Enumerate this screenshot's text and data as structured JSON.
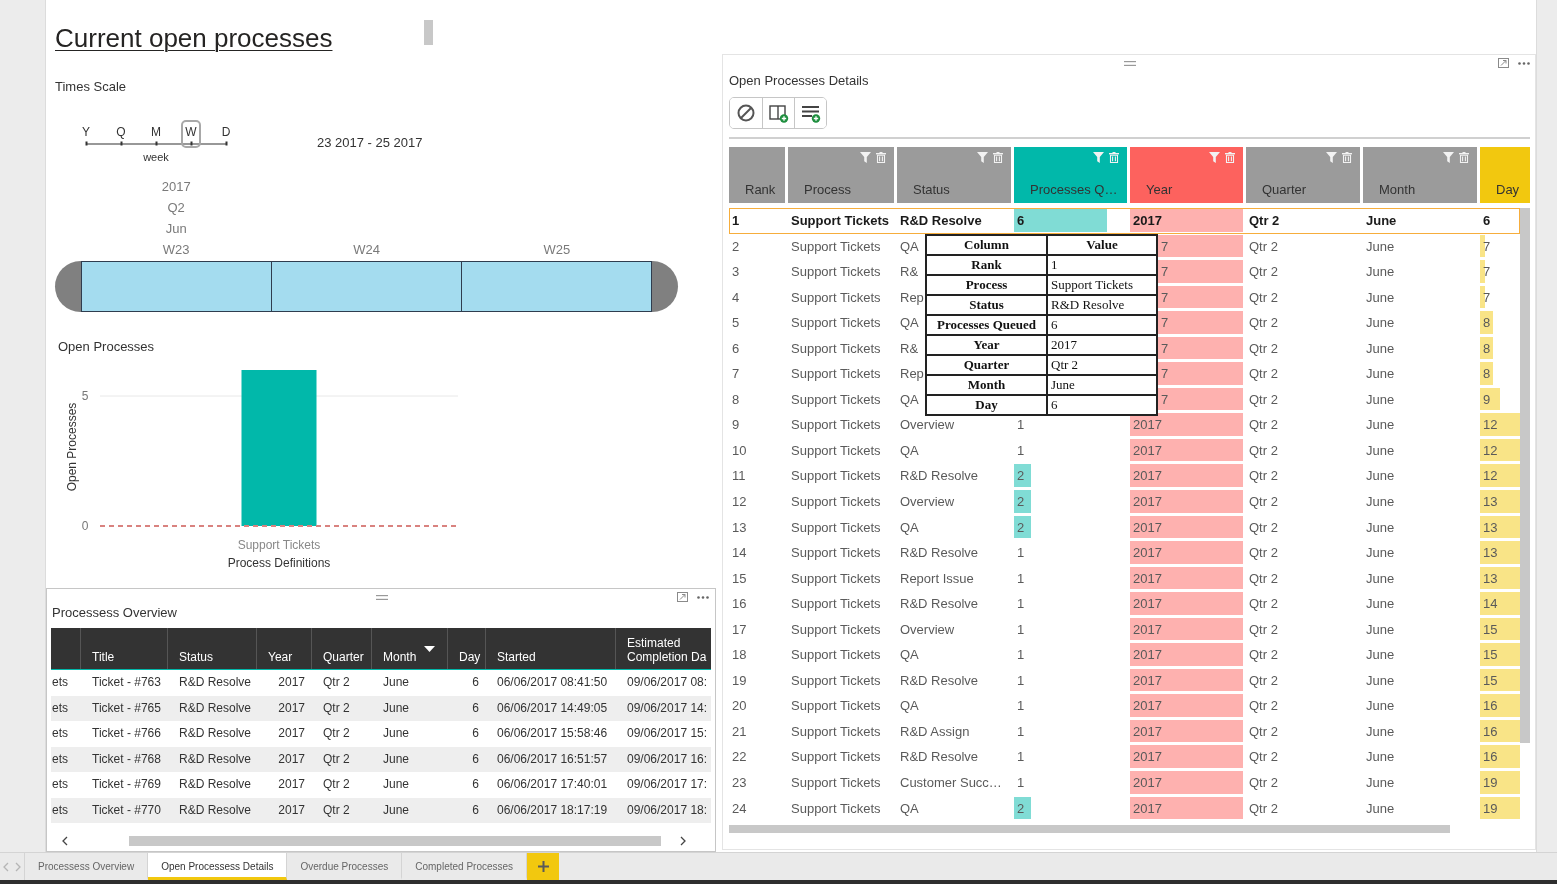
{
  "page": {
    "title": "Current open processes"
  },
  "time_scale": {
    "title": "Times Scale",
    "levels": [
      {
        "label": "Y",
        "selected": false
      },
      {
        "label": "Q",
        "selected": false
      },
      {
        "label": "M",
        "selected": false
      },
      {
        "label": "W",
        "selected": true
      },
      {
        "label": "D",
        "selected": false
      }
    ],
    "level_caption": "week",
    "range": "23 2017 - 25 2017",
    "year": "2017",
    "quarter": "Q2",
    "month": "Jun",
    "periods": [
      {
        "label": "W23",
        "selected": true
      },
      {
        "label": "W24",
        "selected": true
      },
      {
        "label": "W25",
        "selected": true
      }
    ]
  },
  "open_processes": {
    "title": "Open Processes",
    "chart_data": {
      "type": "bar",
      "categories": [
        "Support Tickets"
      ],
      "values": [
        6
      ],
      "color": "#01b8aa",
      "xlabel": "Process Definitions",
      "ylabel": "Open Processes",
      "yticks": [
        0,
        5
      ],
      "ylim": [
        0,
        6
      ],
      "grid": true,
      "ref_lines": [
        {
          "axis": "y",
          "value": 0,
          "color": "#d9827f",
          "line_style": "dashed"
        }
      ]
    }
  },
  "overview": {
    "title": "Processess Overview",
    "columns": [
      {
        "kind": "text"
      },
      {
        "label": "Title",
        "kind": "text"
      },
      {
        "label": "Status",
        "kind": "text"
      },
      {
        "label": "Year",
        "kind": "number"
      },
      {
        "label": "Quarter",
        "kind": "text"
      },
      {
        "label": "Month",
        "kind": "text",
        "sort_descending": true
      },
      {
        "label": "Day",
        "kind": "number"
      },
      {
        "label": "Started",
        "kind": "text"
      },
      {
        "label": "Estimated Completion Da",
        "kind": "text"
      }
    ],
    "rows": [
      [
        "ets",
        "Ticket - #763",
        "R&D Resolve",
        "2017",
        "Qtr 2",
        "June",
        "6",
        "06/06/2017 08:41:50",
        "09/06/2017 08:"
      ],
      [
        "ets",
        "Ticket - #765",
        "R&D Resolve",
        "2017",
        "Qtr 2",
        "June",
        "6",
        "06/06/2017 14:49:05",
        "09/06/2017 14:"
      ],
      [
        "ets",
        "Ticket - #766",
        "R&D Resolve",
        "2017",
        "Qtr 2",
        "June",
        "6",
        "06/06/2017 15:58:46",
        "09/06/2017 15:"
      ],
      [
        "ets",
        "Ticket - #768",
        "R&D Resolve",
        "2017",
        "Qtr 2",
        "June",
        "6",
        "06/06/2017 16:51:57",
        "09/06/2017 16:"
      ],
      [
        "ets",
        "Ticket - #769",
        "R&D Resolve",
        "2017",
        "Qtr 2",
        "June",
        "6",
        "06/06/2017 17:40:01",
        "09/06/2017 17:"
      ],
      [
        "ets",
        "Ticket - #770",
        "R&D Resolve",
        "2017",
        "Qtr 2",
        "June",
        "6",
        "06/06/2017 18:17:19",
        "09/06/2017 18:"
      ]
    ]
  },
  "details": {
    "title": "Open Processes Details",
    "columns": [
      {
        "label": "Rank",
        "kind": "text",
        "color": "#9b9b9b",
        "filter_icons": false
      },
      {
        "label": "Process",
        "kind": "text",
        "color": "#9b9b9b",
        "filter_icons": true
      },
      {
        "label": "Status",
        "kind": "text",
        "color": "#9b9b9b",
        "filter_icons": true
      },
      {
        "label": "Processes Q…",
        "kind": "bar",
        "color": "#01b8aa",
        "filter_icons": true
      },
      {
        "label": "Year",
        "kind": "bar",
        "color": "#fd625e",
        "filter_icons": true
      },
      {
        "label": "Quarter",
        "kind": "text",
        "color": "#9b9b9b",
        "filter_icons": true
      },
      {
        "label": "Month",
        "kind": "text",
        "color": "#9b9b9b",
        "filter_icons": true
      },
      {
        "label": "Day",
        "kind": "bar",
        "color": "#f2c80f",
        "filter_icons": false
      }
    ],
    "rows": [
      {
        "selected": true,
        "cells": [
          "1",
          "Support Tickets",
          "R&D Resolve",
          {
            "text": "6",
            "level": 0.82
          },
          {
            "text": "2017",
            "level": 1
          },
          "Qtr 2",
          "June",
          {
            "text": "6"
          }
        ]
      },
      {
        "selected": false,
        "cells": [
          "2",
          "Support Tickets",
          "QA",
          null,
          {
            "text": "7",
            "level": 1
          },
          "Qtr 2",
          "June",
          {
            "text": "7",
            "level": 0.12
          }
        ]
      },
      {
        "selected": false,
        "cells": [
          "3",
          "Support Tickets",
          "R&",
          null,
          {
            "text": "7",
            "level": 1
          },
          "Qtr 2",
          "June",
          {
            "text": "7",
            "level": 0.12
          }
        ]
      },
      {
        "selected": false,
        "cells": [
          "4",
          "Support Tickets",
          "Rep",
          null,
          {
            "text": "7",
            "level": 1
          },
          "Qtr 2",
          "June",
          {
            "text": "7",
            "level": 0.12
          }
        ]
      },
      {
        "selected": false,
        "cells": [
          "5",
          "Support Tickets",
          "QA",
          null,
          {
            "text": "7",
            "level": 1
          },
          "Qtr 2",
          "June",
          {
            "text": "8",
            "level": 0.32
          }
        ]
      },
      {
        "selected": false,
        "cells": [
          "6",
          "Support Tickets",
          "R&",
          null,
          {
            "text": "7",
            "level": 1
          },
          "Qtr 2",
          "June",
          {
            "text": "8",
            "level": 0.32
          }
        ]
      },
      {
        "selected": false,
        "cells": [
          "7",
          "Support Tickets",
          "Rep",
          null,
          {
            "text": "7",
            "level": 1
          },
          "Qtr 2",
          "June",
          {
            "text": "8",
            "level": 0.32
          }
        ]
      },
      {
        "selected": false,
        "cells": [
          "8",
          "Support Tickets",
          "QA",
          null,
          {
            "text": "7",
            "level": 1
          },
          "Qtr 2",
          "June",
          {
            "text": "9",
            "level": 0.5
          }
        ]
      },
      {
        "selected": false,
        "cells": [
          "9",
          "Support Tickets",
          "Overview",
          {
            "text": "1"
          },
          {
            "text": "2017",
            "level": 1
          },
          "Qtr 2",
          "June",
          {
            "text": "12",
            "level": 1
          }
        ]
      },
      {
        "selected": false,
        "cells": [
          "10",
          "Support Tickets",
          "QA",
          {
            "text": "1"
          },
          {
            "text": "2017",
            "level": 1
          },
          "Qtr 2",
          "June",
          {
            "text": "12",
            "level": 1
          }
        ]
      },
      {
        "selected": false,
        "cells": [
          "11",
          "Support Tickets",
          "R&D Resolve",
          {
            "text": "2",
            "level": 0.15
          },
          {
            "text": "2017",
            "level": 1
          },
          "Qtr 2",
          "June",
          {
            "text": "12",
            "level": 1
          }
        ]
      },
      {
        "selected": false,
        "cells": [
          "12",
          "Support Tickets",
          "Overview",
          {
            "text": "2",
            "level": 0.15
          },
          {
            "text": "2017",
            "level": 1
          },
          "Qtr 2",
          "June",
          {
            "text": "13",
            "level": 1
          }
        ]
      },
      {
        "selected": false,
        "cells": [
          "13",
          "Support Tickets",
          "QA",
          {
            "text": "2",
            "level": 0.15
          },
          {
            "text": "2017",
            "level": 1
          },
          "Qtr 2",
          "June",
          {
            "text": "13",
            "level": 1
          }
        ]
      },
      {
        "selected": false,
        "cells": [
          "14",
          "Support Tickets",
          "R&D Resolve",
          {
            "text": "1"
          },
          {
            "text": "2017",
            "level": 1
          },
          "Qtr 2",
          "June",
          {
            "text": "13",
            "level": 1
          }
        ]
      },
      {
        "selected": false,
        "cells": [
          "15",
          "Support Tickets",
          "Report Issue",
          {
            "text": "1"
          },
          {
            "text": "2017",
            "level": 1
          },
          "Qtr 2",
          "June",
          {
            "text": "13",
            "level": 1
          }
        ]
      },
      {
        "selected": false,
        "cells": [
          "16",
          "Support Tickets",
          "R&D Resolve",
          {
            "text": "1"
          },
          {
            "text": "2017",
            "level": 1
          },
          "Qtr 2",
          "June",
          {
            "text": "14",
            "level": 1
          }
        ]
      },
      {
        "selected": false,
        "cells": [
          "17",
          "Support Tickets",
          "Overview",
          {
            "text": "1"
          },
          {
            "text": "2017",
            "level": 1
          },
          "Qtr 2",
          "June",
          {
            "text": "15",
            "level": 1
          }
        ]
      },
      {
        "selected": false,
        "cells": [
          "18",
          "Support Tickets",
          "QA",
          {
            "text": "1"
          },
          {
            "text": "2017",
            "level": 1
          },
          "Qtr 2",
          "June",
          {
            "text": "15",
            "level": 1
          }
        ]
      },
      {
        "selected": false,
        "cells": [
          "19",
          "Support Tickets",
          "R&D Resolve",
          {
            "text": "1"
          },
          {
            "text": "2017",
            "level": 1
          },
          "Qtr 2",
          "June",
          {
            "text": "15",
            "level": 1
          }
        ]
      },
      {
        "selected": false,
        "cells": [
          "20",
          "Support Tickets",
          "QA",
          {
            "text": "1"
          },
          {
            "text": "2017",
            "level": 1
          },
          "Qtr 2",
          "June",
          {
            "text": "16",
            "level": 1
          }
        ]
      },
      {
        "selected": false,
        "cells": [
          "21",
          "Support Tickets",
          "R&D Assign",
          {
            "text": "1"
          },
          {
            "text": "2017",
            "level": 1
          },
          "Qtr 2",
          "June",
          {
            "text": "16",
            "level": 1
          }
        ]
      },
      {
        "selected": false,
        "cells": [
          "22",
          "Support Tickets",
          "R&D Resolve",
          {
            "text": "1"
          },
          {
            "text": "2017",
            "level": 1
          },
          "Qtr 2",
          "June",
          {
            "text": "16",
            "level": 1
          }
        ]
      },
      {
        "selected": false,
        "cells": [
          "23",
          "Support Tickets",
          "Customer Succ…",
          {
            "text": "1"
          },
          {
            "text": "2017",
            "level": 1
          },
          "Qtr 2",
          "June",
          {
            "text": "19",
            "level": 1
          }
        ]
      },
      {
        "selected": false,
        "cells": [
          "24",
          "Support Tickets",
          "QA",
          {
            "text": "2",
            "level": 0.15
          },
          {
            "text": "2017",
            "level": 1
          },
          "Qtr 2",
          "June",
          {
            "text": "19",
            "level": 1
          }
        ]
      }
    ],
    "tooltip": {
      "columns": [
        "Column",
        "Value"
      ],
      "rows": [
        [
          "Rank",
          "1"
        ],
        [
          "Process",
          "Support Tickets"
        ],
        [
          "Status",
          "R&D Resolve"
        ],
        [
          "Processes Queued",
          "6"
        ],
        [
          "Year",
          "2017"
        ],
        [
          "Quarter",
          "Qtr 2"
        ],
        [
          "Month",
          "June"
        ],
        [
          "Day",
          "6"
        ]
      ]
    }
  },
  "tabs": [
    {
      "label": "Processess Overview",
      "selected": false
    },
    {
      "label": "Open Processess Details",
      "selected": true
    },
    {
      "label": "Overdue Processes",
      "selected": false
    },
    {
      "label": "Completed Processes",
      "selected": false
    }
  ]
}
